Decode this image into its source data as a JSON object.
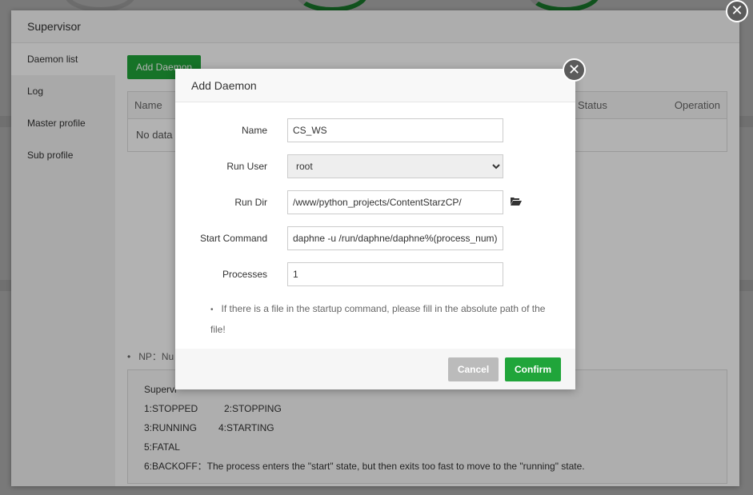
{
  "supervisor": {
    "title": "Supervisor",
    "sidebar": {
      "items": [
        {
          "label": "Daemon list"
        },
        {
          "label": "Log"
        },
        {
          "label": "Master profile"
        },
        {
          "label": "Sub profile"
        }
      ]
    },
    "add_daemon_button": "Add Daemon",
    "table": {
      "columns": [
        "Name",
        "Status",
        "Operation"
      ],
      "empty_text": "No data d"
    },
    "np_note": "NP：Nu",
    "status_box": {
      "heading": "Supervi",
      "lines": [
        [
          "1:STOPPED",
          "2:STOPPING"
        ],
        [
          "3:RUNNING",
          "4:STARTING"
        ],
        [
          "5:FATAL"
        ]
      ],
      "backoff": "6:BACKOFF：The process enters the \"start\" state, but then exits too fast to move to the \"running\" state."
    }
  },
  "modal": {
    "title": "Add Daemon",
    "fields": {
      "name": {
        "label": "Name",
        "value": "CS_WS"
      },
      "run_user": {
        "label": "Run User",
        "value": "root",
        "options": [
          "root"
        ]
      },
      "run_dir": {
        "label": "Run Dir",
        "value": "/www/python_projects/ContentStarzCP/"
      },
      "start_command": {
        "label": "Start Command",
        "value": "daphne -u /run/daphne/daphne%(process_num)d"
      },
      "processes": {
        "label": "Processes",
        "value": "1"
      }
    },
    "hint": "If there is a file in the startup command, please fill in the absolute path of the file!",
    "cancel_label": "Cancel",
    "confirm_label": "Confirm"
  },
  "icons": {
    "close": "close-icon",
    "folder": "folder-open-icon"
  },
  "colors": {
    "accent": "#20a53a",
    "close_bg": "#5b5b5b",
    "cancel_bg": "#bbbbbb"
  }
}
